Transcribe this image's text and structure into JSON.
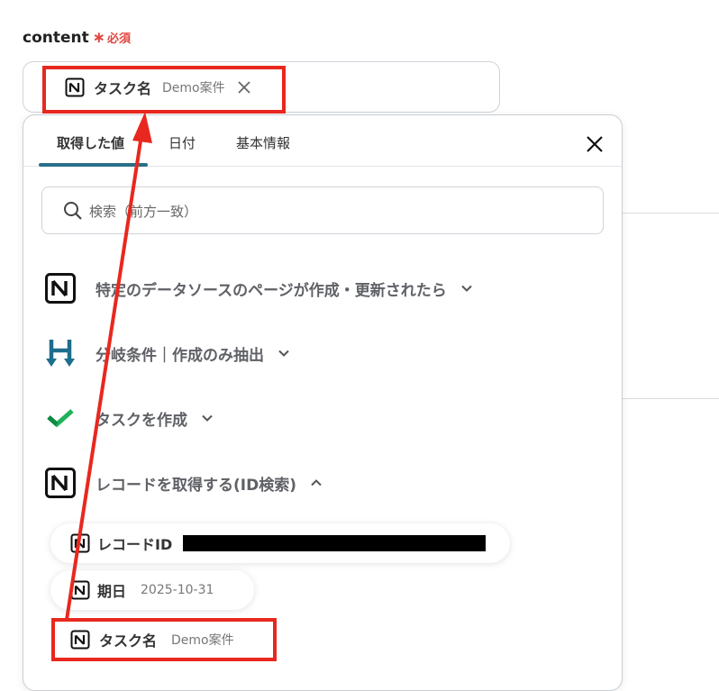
{
  "field": {
    "label": "content",
    "required_mark": "∗",
    "required_text": "必須",
    "selected_chip": {
      "label": "タスク名",
      "sub": "Demo案件"
    }
  },
  "panel": {
    "tabs": [
      "取得した値",
      "日付",
      "基本情報"
    ],
    "active_tab": 0,
    "search_placeholder": "検索（前方一致）",
    "sections": [
      {
        "icon": "notion-icon",
        "label": "特定のデータソースのページが作成・更新されたら",
        "expanded": false
      },
      {
        "icon": "yoom-branch-icon",
        "label": "分岐条件｜作成のみ抽出",
        "expanded": false
      },
      {
        "icon": "check-app-icon",
        "label": "タスクを作成",
        "expanded": false
      },
      {
        "icon": "notion-icon",
        "label": "レコードを取得する(ID検索)",
        "expanded": true
      }
    ],
    "items": [
      {
        "label": "レコードID",
        "value": ""
      },
      {
        "label": "期日",
        "value": "2025-10-31"
      },
      {
        "label": "タスク名",
        "value": "Demo案件"
      }
    ]
  },
  "colors": {
    "accent": "#2a6f89",
    "highlight": "#e8281e",
    "required": "#e2453c"
  }
}
